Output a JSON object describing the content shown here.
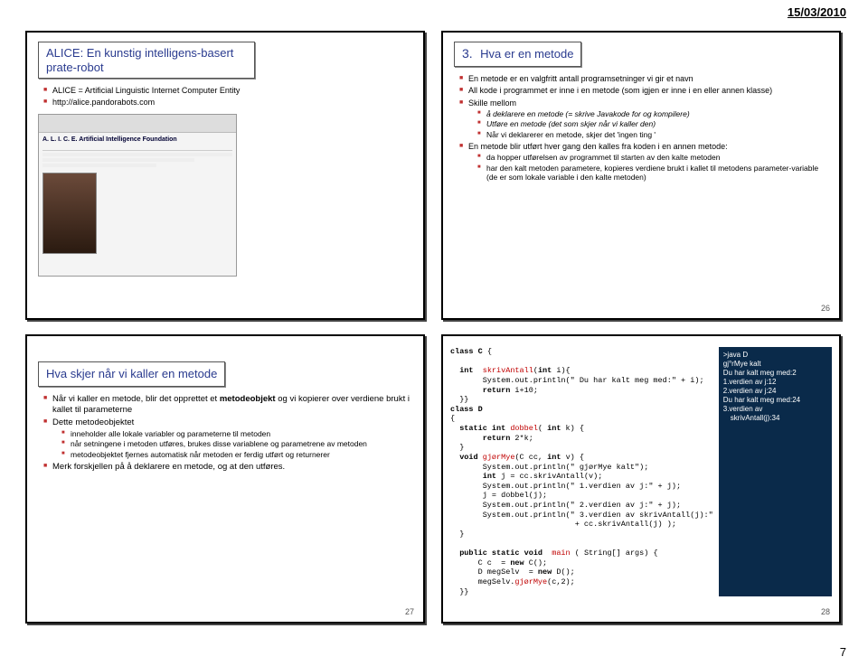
{
  "page": {
    "date": "15/03/2010",
    "num": "7"
  },
  "slide1": {
    "title": "ALICE: En kunstig intelligens-basert prate-robot",
    "b1": "ALICE = Artificial Linguistic Internet Computer Entity",
    "b2": "http://alice.pandorabots.com",
    "aif": "A. L. I. C. E. Artificial Intelligence Foundation"
  },
  "slide2": {
    "num": "3.",
    "title": "Hva er en metode",
    "b1": "En metode er en valgfritt antall programsetninger vi gir et navn",
    "b2": "All kode i programmet er inne i en metode (som igjen er inne i en eller annen klasse)",
    "b3": "Skille mellom",
    "s3a": "å deklarere en metode (= skrive Javakode for og kompilere)",
    "s3b": "Utføre en metode (det som skjer når vi kaller den)",
    "s3c": "Når vi deklarerer en metode, skjer det 'ingen ting '",
    "b4": "En metode blir utført hver gang den kalles fra koden i en annen metode:",
    "s4a": "da hopper utførelsen av programmet til starten av den kalte metoden",
    "s4b": "har den kalt metoden parametere, kopieres verdiene brukt i kallet til metodens parameter-variable (de er som lokale variable i den kalte metoden)",
    "slidenum": "26"
  },
  "slide3": {
    "title": "Hva skjer når vi kaller en metode",
    "b1": "Når vi kaller en metode, blir det opprettet et metodeobjekt og vi kopierer over verdiene brukt i kallet til parameterne",
    "b2": "Dette metodeobjektet",
    "s2a": "inneholder alle lokale variabler og parameterne til metoden",
    "s2b": "når setningene i metoden utføres, brukes disse variablene og parametrene av metoden",
    "s2c": "metodeobjektet fjernes automatisk når metoden er ferdig utført og returnerer",
    "b3": "Merk forskjellen på å deklarere en metode, og at den utføres.",
    "slidenum": "27"
  },
  "slide4": {
    "code": "class C {\n\n  int  skrivAntall(int i){\n       System.out.println(\" Du har kalt meg med:\" + i);\n       return i+10;\n  }}\nclass D\n{\n  static int dobbel( int k) {\n       return 2*k;\n  }\n  void gjørMye(C cc, int v) {\n       System.out.println(\" gjørMye kalt\");\n       int j = cc.skrivAntall(v);\n       System.out.println(\" 1.verdien av j:\" + j);\n       j = dobbel(j);\n       System.out.println(\" 2.verdien av j:\" + j);\n       System.out.println(\" 3.verdien av skrivAntall(j):\"\n                           + cc.skrivAntall(j) );\n  }\n\n  public static void  main ( String[] args) {\n      C c  = new C();\n      D megSelv  = new D();\n      megSelv.gjørMye(c,2);\n  }}",
    "out1": ">java D",
    "out2": "gj°rMye kalt",
    "out3": "Du har kalt meg med:2",
    "out4": "1.verdien av j:12",
    "out5": "2.verdien av j:24",
    "out6": "Du har kalt meg med:24",
    "out7": "3.verdien av",
    "out8": "skrivAntall(j):34",
    "slidenum": "28"
  }
}
